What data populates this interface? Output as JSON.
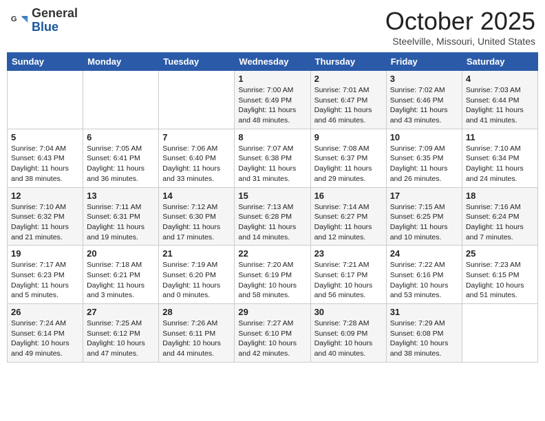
{
  "header": {
    "logo_general": "General",
    "logo_blue": "Blue",
    "month": "October 2025",
    "location": "Steelville, Missouri, United States"
  },
  "weekdays": [
    "Sunday",
    "Monday",
    "Tuesday",
    "Wednesday",
    "Thursday",
    "Friday",
    "Saturday"
  ],
  "weeks": [
    [
      {
        "day": "",
        "info": ""
      },
      {
        "day": "",
        "info": ""
      },
      {
        "day": "",
        "info": ""
      },
      {
        "day": "1",
        "info": "Sunrise: 7:00 AM\nSunset: 6:49 PM\nDaylight: 11 hours\nand 48 minutes."
      },
      {
        "day": "2",
        "info": "Sunrise: 7:01 AM\nSunset: 6:47 PM\nDaylight: 11 hours\nand 46 minutes."
      },
      {
        "day": "3",
        "info": "Sunrise: 7:02 AM\nSunset: 6:46 PM\nDaylight: 11 hours\nand 43 minutes."
      },
      {
        "day": "4",
        "info": "Sunrise: 7:03 AM\nSunset: 6:44 PM\nDaylight: 11 hours\nand 41 minutes."
      }
    ],
    [
      {
        "day": "5",
        "info": "Sunrise: 7:04 AM\nSunset: 6:43 PM\nDaylight: 11 hours\nand 38 minutes."
      },
      {
        "day": "6",
        "info": "Sunrise: 7:05 AM\nSunset: 6:41 PM\nDaylight: 11 hours\nand 36 minutes."
      },
      {
        "day": "7",
        "info": "Sunrise: 7:06 AM\nSunset: 6:40 PM\nDaylight: 11 hours\nand 33 minutes."
      },
      {
        "day": "8",
        "info": "Sunrise: 7:07 AM\nSunset: 6:38 PM\nDaylight: 11 hours\nand 31 minutes."
      },
      {
        "day": "9",
        "info": "Sunrise: 7:08 AM\nSunset: 6:37 PM\nDaylight: 11 hours\nand 29 minutes."
      },
      {
        "day": "10",
        "info": "Sunrise: 7:09 AM\nSunset: 6:35 PM\nDaylight: 11 hours\nand 26 minutes."
      },
      {
        "day": "11",
        "info": "Sunrise: 7:10 AM\nSunset: 6:34 PM\nDaylight: 11 hours\nand 24 minutes."
      }
    ],
    [
      {
        "day": "12",
        "info": "Sunrise: 7:10 AM\nSunset: 6:32 PM\nDaylight: 11 hours\nand 21 minutes."
      },
      {
        "day": "13",
        "info": "Sunrise: 7:11 AM\nSunset: 6:31 PM\nDaylight: 11 hours\nand 19 minutes."
      },
      {
        "day": "14",
        "info": "Sunrise: 7:12 AM\nSunset: 6:30 PM\nDaylight: 11 hours\nand 17 minutes."
      },
      {
        "day": "15",
        "info": "Sunrise: 7:13 AM\nSunset: 6:28 PM\nDaylight: 11 hours\nand 14 minutes."
      },
      {
        "day": "16",
        "info": "Sunrise: 7:14 AM\nSunset: 6:27 PM\nDaylight: 11 hours\nand 12 minutes."
      },
      {
        "day": "17",
        "info": "Sunrise: 7:15 AM\nSunset: 6:25 PM\nDaylight: 11 hours\nand 10 minutes."
      },
      {
        "day": "18",
        "info": "Sunrise: 7:16 AM\nSunset: 6:24 PM\nDaylight: 11 hours\nand 7 minutes."
      }
    ],
    [
      {
        "day": "19",
        "info": "Sunrise: 7:17 AM\nSunset: 6:23 PM\nDaylight: 11 hours\nand 5 minutes."
      },
      {
        "day": "20",
        "info": "Sunrise: 7:18 AM\nSunset: 6:21 PM\nDaylight: 11 hours\nand 3 minutes."
      },
      {
        "day": "21",
        "info": "Sunrise: 7:19 AM\nSunset: 6:20 PM\nDaylight: 11 hours\nand 0 minutes."
      },
      {
        "day": "22",
        "info": "Sunrise: 7:20 AM\nSunset: 6:19 PM\nDaylight: 10 hours\nand 58 minutes."
      },
      {
        "day": "23",
        "info": "Sunrise: 7:21 AM\nSunset: 6:17 PM\nDaylight: 10 hours\nand 56 minutes."
      },
      {
        "day": "24",
        "info": "Sunrise: 7:22 AM\nSunset: 6:16 PM\nDaylight: 10 hours\nand 53 minutes."
      },
      {
        "day": "25",
        "info": "Sunrise: 7:23 AM\nSunset: 6:15 PM\nDaylight: 10 hours\nand 51 minutes."
      }
    ],
    [
      {
        "day": "26",
        "info": "Sunrise: 7:24 AM\nSunset: 6:14 PM\nDaylight: 10 hours\nand 49 minutes."
      },
      {
        "day": "27",
        "info": "Sunrise: 7:25 AM\nSunset: 6:12 PM\nDaylight: 10 hours\nand 47 minutes."
      },
      {
        "day": "28",
        "info": "Sunrise: 7:26 AM\nSunset: 6:11 PM\nDaylight: 10 hours\nand 44 minutes."
      },
      {
        "day": "29",
        "info": "Sunrise: 7:27 AM\nSunset: 6:10 PM\nDaylight: 10 hours\nand 42 minutes."
      },
      {
        "day": "30",
        "info": "Sunrise: 7:28 AM\nSunset: 6:09 PM\nDaylight: 10 hours\nand 40 minutes."
      },
      {
        "day": "31",
        "info": "Sunrise: 7:29 AM\nSunset: 6:08 PM\nDaylight: 10 hours\nand 38 minutes."
      },
      {
        "day": "",
        "info": ""
      }
    ]
  ]
}
